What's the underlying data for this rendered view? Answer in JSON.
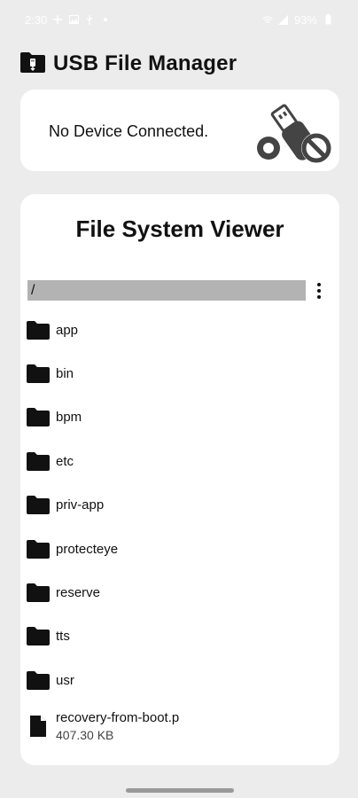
{
  "status_bar": {
    "time": "2:30",
    "battery": "93%",
    "left_icons": [
      "charge-icon",
      "gallery-icon",
      "usb-icon",
      "dot-icon"
    ],
    "right_icons": [
      "wifi-icon",
      "signal-icon",
      "battery-icon"
    ]
  },
  "app": {
    "title": "USB File Manager",
    "icon": "usb-folder-icon"
  },
  "device_card": {
    "message": "No Device Connected.",
    "illustration": "usb-drive-disconnected-icon"
  },
  "file_system": {
    "title": "File System Viewer",
    "current_path": "/",
    "menu_icon": "more-vert-icon",
    "items": [
      {
        "name": "app",
        "type": "folder"
      },
      {
        "name": "bin",
        "type": "folder"
      },
      {
        "name": "bpm",
        "type": "folder"
      },
      {
        "name": "etc",
        "type": "folder"
      },
      {
        "name": "priv-app",
        "type": "folder"
      },
      {
        "name": "protecteye",
        "type": "folder"
      },
      {
        "name": "reserve",
        "type": "folder"
      },
      {
        "name": "tts",
        "type": "folder"
      },
      {
        "name": "usr",
        "type": "folder"
      },
      {
        "name": "recovery-from-boot.p",
        "type": "file",
        "size": "407.30 KB"
      }
    ]
  },
  "colors": {
    "background": "#ececec",
    "card": "#ffffff",
    "path_bar": "#b3b3b3",
    "text": "#111111"
  }
}
